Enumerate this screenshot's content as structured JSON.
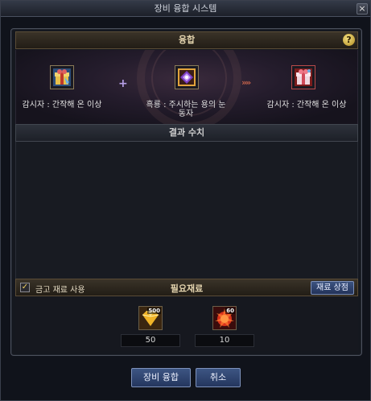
{
  "window": {
    "title": "장비 융합 시스템",
    "close_label": "×"
  },
  "fusion": {
    "header": "융합",
    "help_label": "?",
    "plus_symbol": "+",
    "arrow_symbol": "»»",
    "left_item": {
      "name": "감시자 : 간작해 온 이상",
      "icon": "gift-box-icon"
    },
    "center_item": {
      "name": "흑룡 : 주시하는 용의 눈동자",
      "icon": "purple-gem-icon"
    },
    "right_item": {
      "name": "감시자 : 간작해 온 이상",
      "icon": "gift-box-icon"
    }
  },
  "result": {
    "header": "결과 수치"
  },
  "materials": {
    "checkbox_checked": true,
    "checkbox_mark": "✓",
    "checkbox_label": "금고 재료 사용",
    "header": "필요재료",
    "shop_button": "재료 상점",
    "items": [
      {
        "icon": "gold-crystal-icon",
        "badge": "500",
        "quantity": "50"
      },
      {
        "icon": "red-burst-icon",
        "badge": "60",
        "quantity": "10"
      }
    ]
  },
  "buttons": {
    "fuse": "장비 융합",
    "cancel": "취소"
  },
  "colors": {
    "accent_gold": "#e6d6b0",
    "button_blue": "#24365e",
    "fusion_arrow": "#c0604a"
  }
}
